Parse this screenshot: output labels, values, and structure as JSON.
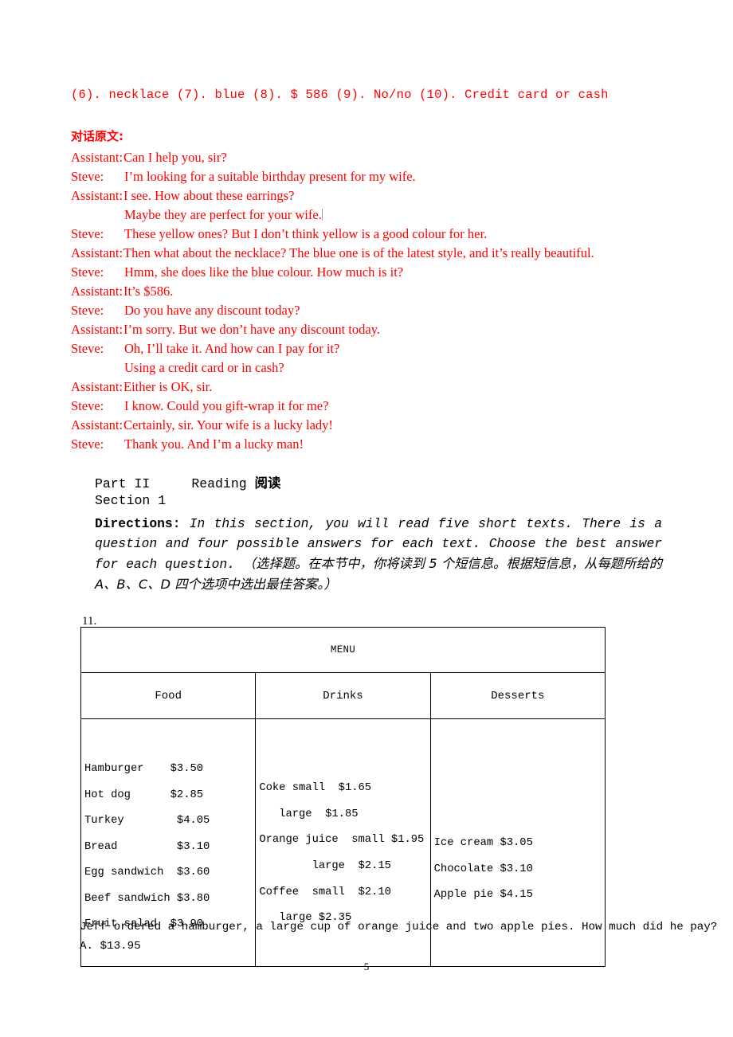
{
  "answer_key": {
    "line": "(6). necklace (7). blue (8). $ 586 (9). No/no (10). Credit card or cash",
    "color": "#ff0000"
  },
  "transcript": {
    "heading": "对话原文:",
    "color": "#ff0000",
    "lines": [
      {
        "speaker": "Assistant:",
        "text": "Can I help you, sir?",
        "style": "assistant"
      },
      {
        "speaker": "Steve:",
        "text": "I’m looking for a suitable birthday present for my wife.",
        "style": "steve"
      },
      {
        "speaker": "Assistant:",
        "text": "I see. How about these earrings?",
        "style": "assistant"
      },
      {
        "speaker": "",
        "text": "Maybe they are perfect for your wife.",
        "style": "continuation",
        "caret": true
      },
      {
        "speaker": "Steve:",
        "text": "These yellow ones? But I don’t think yellow is a good colour for her.",
        "style": "steve"
      },
      {
        "speaker": "Assistant:",
        "text": "Then what about the necklace? The blue one is of the latest style, and it’s really beautiful.",
        "style": "assistant"
      },
      {
        "speaker": "Steve:",
        "text": "Hmm, she does like the blue colour. How much is it?",
        "style": "steve"
      },
      {
        "speaker": "Assistant:",
        "text": "It’s $586.",
        "style": "assistant"
      },
      {
        "speaker": "Steve:",
        "text": "Do you have any discount today?",
        "style": "steve"
      },
      {
        "speaker": "Assistant:",
        "text": "I’m sorry. But we don’t have any discount today.",
        "style": "assistant"
      },
      {
        "speaker": "Steve:",
        "text": "Oh, I’ll take it. And how can I pay for it?",
        "style": "steve"
      },
      {
        "speaker": "",
        "text": "Using a credit card or in cash?",
        "style": "continuation"
      },
      {
        "speaker": "Assistant:",
        "text": "Either is OK, sir.",
        "style": "assistant"
      },
      {
        "speaker": "Steve:",
        "text": "I know. Could you gift-wrap it for me?",
        "style": "steve"
      },
      {
        "speaker": "Assistant:",
        "text": "Certainly, sir. Your wife is a lucky lady!",
        "style": "assistant"
      },
      {
        "speaker": "Steve:",
        "text": "Thank you. And I’m a lucky man!",
        "style": "steve"
      }
    ]
  },
  "part": {
    "label": "Part II",
    "name_en": "Reading",
    "name_cn": "阅读",
    "section": "Section 1",
    "directions_label": "Directions:",
    "directions_en": "In this section, you will read five short texts. There is a question and four possible answers for each text. Choose the best answer for each question.",
    "directions_cn": "（选择题。在本节中，你将读到 5 个短信息。根据短信息，从每题所给的 A、B、C、D 四个选项中选出最佳答案。）"
  },
  "question": {
    "number": "11.",
    "stem": "Jeff ordered a hamburger, a large cup of orange juice and two apple pies. How much did he pay?",
    "options": [
      "A. $13.95"
    ]
  },
  "menu": {
    "banner": "MENU",
    "columns": [
      "Food",
      "Drinks",
      "Desserts"
    ],
    "food": [
      "Hamburger    $3.50",
      "Hot dog      $2.85",
      "Turkey        $4.05",
      "Bread         $3.10",
      "Egg sandwich  $3.60",
      "Beef sandwich $3.80",
      "Fruit salad  $3.90"
    ],
    "drinks": [
      "Coke small  $1.65",
      "   large  $1.85",
      "Orange juice  small $1.95",
      "        large  $2.15",
      "Coffee  small  $2.10",
      "   large $2.35"
    ],
    "desserts": [
      "Ice cream $3.05",
      "Chocolate $3.10",
      "Apple pie $4.15"
    ]
  },
  "footer": {
    "page_number": "5"
  }
}
